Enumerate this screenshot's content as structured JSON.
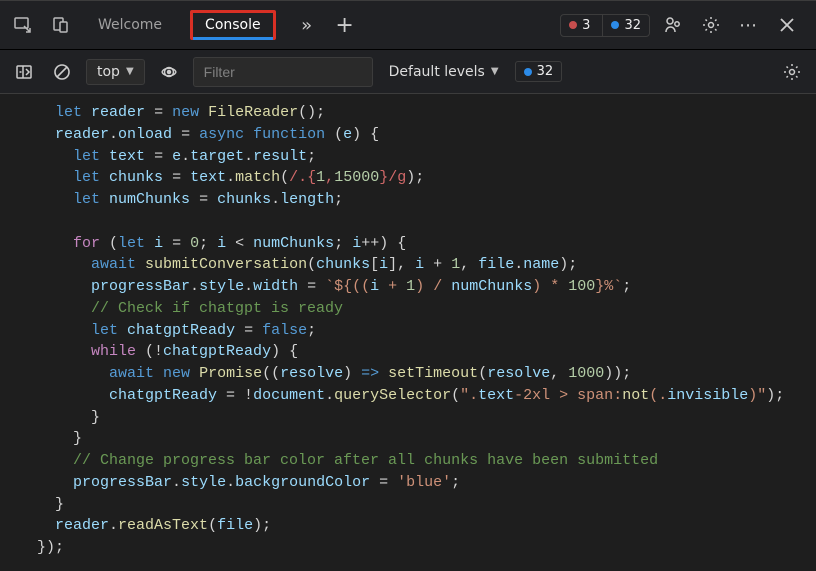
{
  "tabbar": {
    "tabs": [
      {
        "label": "Welcome",
        "active": false
      },
      {
        "label": "Console",
        "active": true
      }
    ],
    "error_count": "3",
    "info_count": "32"
  },
  "filterbar": {
    "context": "top",
    "filter_placeholder": "Filter",
    "levels_label": "Default levels",
    "info_count": "32"
  },
  "code_lines": [
    "   let reader = new FileReader();",
    "   reader.onload = async function (e) {",
    "     let text = e.target.result;",
    "     let chunks = text.match(/.{1,15000}/g);",
    "     let numChunks = chunks.length;",
    "",
    "     for (let i = 0; i < numChunks; i++) {",
    "       await submitConversation(chunks[i], i + 1, file.name);",
    "       progressBar.style.width = `${((i + 1) / numChunks) * 100}%`;",
    "       // Check if chatgpt is ready",
    "       let chatgptReady = false;",
    "       while (!chatgptReady) {",
    "         await new Promise((resolve) => setTimeout(resolve, 1000));",
    "         chatgptReady = !document.querySelector(\".text-2xl > span:not(.invisible)\");",
    "       }",
    "     }",
    "     // Change progress bar color after all chunks have been submitted",
    "     progressBar.style.backgroundColor = 'blue';",
    "   }",
    "   reader.readAsText(file);",
    " });"
  ]
}
